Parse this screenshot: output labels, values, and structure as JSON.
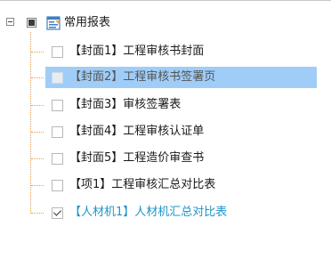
{
  "tree": {
    "root": {
      "label": "常用报表",
      "expander_icon": "minus-expander-icon",
      "checkbox_state": "partial",
      "icon": "report-folder-icon"
    },
    "items": [
      {
        "label": "【封面1】工程审核书封面",
        "checked": false,
        "selected": false
      },
      {
        "label": "【封面2】工程审核书签署页",
        "checked": false,
        "selected": true
      },
      {
        "label": "【封面3】审核签署表",
        "checked": false,
        "selected": false
      },
      {
        "label": "【封面4】工程审核认证单",
        "checked": false,
        "selected": false
      },
      {
        "label": "【封面5】工程造价审查书",
        "checked": false,
        "selected": false
      },
      {
        "label": "【项1】工程审核汇总对比表",
        "checked": false,
        "selected": false
      },
      {
        "label": "【人材机1】人材机汇总对比表",
        "checked": true,
        "selected": false,
        "color": "#1e95c9"
      }
    ]
  },
  "colors": {
    "selection": "#9fcdf7",
    "connector": "#e3a24a",
    "link_text": "#1e95c9"
  }
}
